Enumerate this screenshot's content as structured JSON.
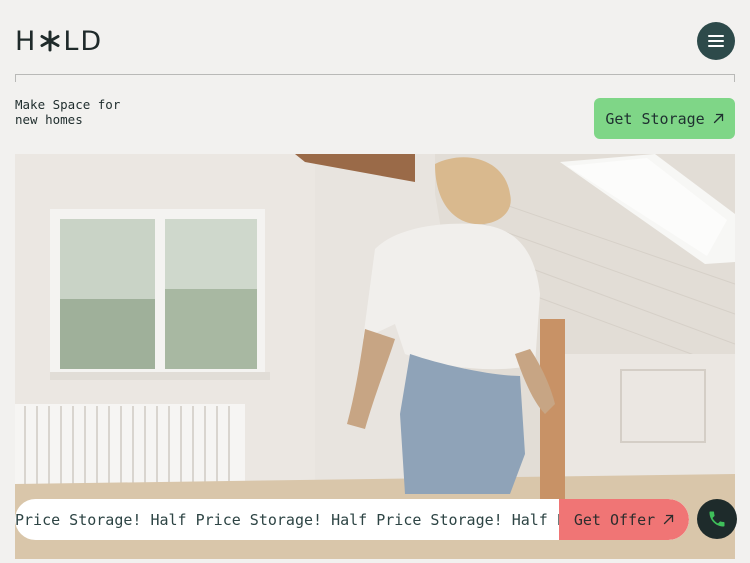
{
  "brand": {
    "logo_left": "H",
    "logo_right": "LD"
  },
  "header": {
    "menu_icon": "hamburger-icon"
  },
  "intro": {
    "tagline_line1": "Make Space for",
    "tagline_line2": "new homes",
    "cta_label": "Get Storage",
    "cta_icon": "arrow-up-right-icon"
  },
  "hero": {
    "image_subject": "person carrying items in bright attic room"
  },
  "ticker": {
    "text": "Price Storage! Half Price Storage! Half Price Storage! Half Pr",
    "offer_label": "Get Offer",
    "offer_icon": "arrow-up-right-icon"
  },
  "contact": {
    "phone_icon": "phone-icon"
  },
  "colors": {
    "background": "#f2f1ef",
    "accent_green": "#7fd687",
    "accent_red": "#f07575",
    "dark_teal": "#2d4a4a",
    "phone_green": "#3fbf5a"
  }
}
